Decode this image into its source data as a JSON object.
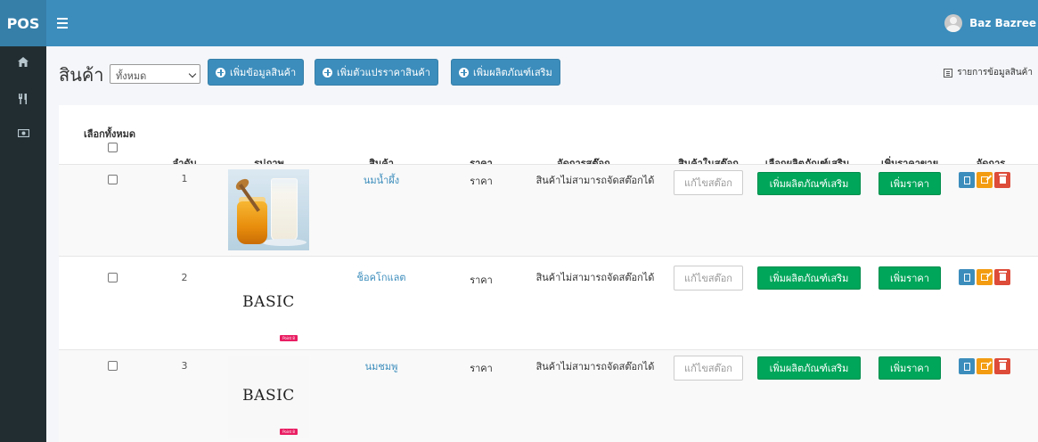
{
  "navbar": {
    "brand": "POS",
    "user_name": "Baz Bazree"
  },
  "sidebar": {
    "items": [
      {
        "icon": "home-icon"
      },
      {
        "icon": "utensils-icon"
      },
      {
        "icon": "money-icon"
      }
    ]
  },
  "header": {
    "title": "สินค้า",
    "filter_selected": "ทั้งหมด",
    "btn_add_product": "เพิ่มข้อมูลสินค้า",
    "btn_add_variant": "เพิ่มตัวแปรราคาสินค้า",
    "btn_add_addon": "เพิ่มผลิตภัณฑ์เสริม",
    "list_link": "รายการข้อมูลสินค้า"
  },
  "table": {
    "select_all_label": "เลือกทั้งหมด",
    "columns": [
      "ลำดับ",
      "รูปภาพ",
      "สินค้า",
      "ราคา",
      "จัดการสต๊อก",
      "สินค้าในสต๊อก",
      "เลือกผลิตภัณฑ์เสริม",
      "เพิ่มราคาขาย",
      "จัดการ"
    ],
    "rows": [
      {
        "no": "1",
        "image": "honey-milk-photo",
        "name": "นมน้ำผึ้ง",
        "price": "ราคา",
        "stock_status": "สินค้าไม่สามารถจัดสต๊อกได้",
        "stock_placeholder": "แก้ไขสต๊อก",
        "addon_button": "เพิ่มผลิตภัณฑ์เสริม",
        "price_button": "เพิ่มราคา"
      },
      {
        "no": "2",
        "image": "basic-logo",
        "image_text": "BASIC",
        "image_tag": "Point 8 Me",
        "name": "ช็อคโกแลต",
        "price": "ราคา",
        "stock_status": "สินค้าไม่สามารถจัดสต๊อกได้",
        "stock_placeholder": "แก้ไขสต๊อก",
        "addon_button": "เพิ่มผลิตภัณฑ์เสริม",
        "price_button": "เพิ่มราคา"
      },
      {
        "no": "3",
        "image": "basic-logo",
        "image_text": "BASIC",
        "image_tag": "Point 8 Me",
        "name": "นมชมพู",
        "price": "ราคา",
        "stock_status": "สินค้าไม่สามารถจัดสต๊อกได้",
        "stock_placeholder": "แก้ไขสต๊อก",
        "addon_button": "เพิ่มผลิตภัณฑ์เสริม",
        "price_button": "เพิ่มราคา"
      }
    ]
  },
  "colors": {
    "navbar": "#3c8dbc",
    "sidebar": "#222d32",
    "success": "#00a65a",
    "warning": "#f39c12",
    "danger": "#dd4b39"
  }
}
